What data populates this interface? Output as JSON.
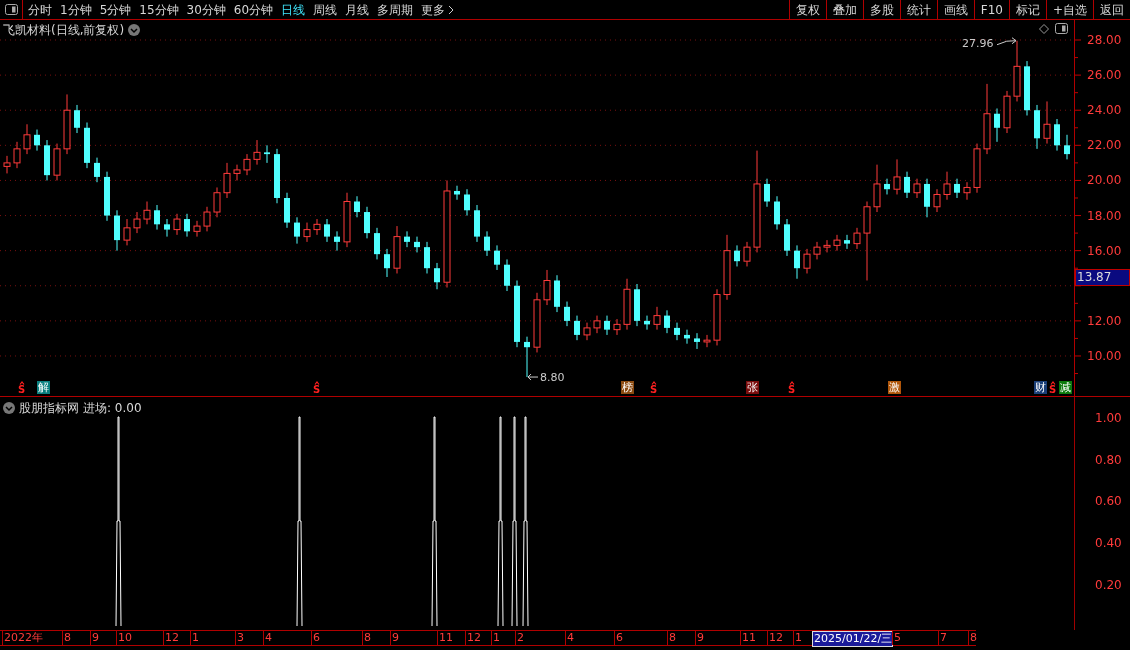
{
  "toolbar": {
    "periods": [
      {
        "label": "分时",
        "selected": false
      },
      {
        "label": "1分钟",
        "selected": false
      },
      {
        "label": "5分钟",
        "selected": false
      },
      {
        "label": "15分钟",
        "selected": false
      },
      {
        "label": "30分钟",
        "selected": false
      },
      {
        "label": "60分钟",
        "selected": false
      },
      {
        "label": "日线",
        "selected": true
      },
      {
        "label": "周线",
        "selected": false
      },
      {
        "label": "月线",
        "selected": false
      },
      {
        "label": "多周期",
        "selected": false
      },
      {
        "label": "更多",
        "selected": false
      }
    ],
    "actions": [
      "复权",
      "叠加",
      "多股",
      "统计",
      "画线",
      "F10",
      "标记",
      "+自选",
      "返回"
    ]
  },
  "chart": {
    "title": "飞凯材料(日线,前复权)",
    "current_price": "13.87",
    "high_label": "27.96",
    "low_label": "8.80",
    "chart_data": {
      "type": "candlestick",
      "ylim": [
        7.72,
        29.14
      ],
      "grid": true,
      "yticks": [
        {
          "value": 28,
          "label": "28.00"
        },
        {
          "value": 26,
          "label": "26.00"
        },
        {
          "value": 24,
          "label": "24.00"
        },
        {
          "value": 22,
          "label": "22.00"
        },
        {
          "value": 20,
          "label": "20.00"
        },
        {
          "value": 18,
          "label": "18.00"
        },
        {
          "value": 16,
          "label": "16.00"
        },
        {
          "value": 12,
          "label": "12.00"
        },
        {
          "value": 10,
          "label": "10.00"
        }
      ],
      "ohlc": [
        [
          20.8,
          21.4,
          20.4,
          21.0
        ],
        [
          21.0,
          22.2,
          20.7,
          21.8
        ],
        [
          21.8,
          23.2,
          21.5,
          22.6
        ],
        [
          22.6,
          22.9,
          21.7,
          22.0
        ],
        [
          22.0,
          22.3,
          20.0,
          20.3
        ],
        [
          20.3,
          22.1,
          20.0,
          21.8
        ],
        [
          21.8,
          24.9,
          21.5,
          24.0
        ],
        [
          24.0,
          24.3,
          22.7,
          23.0
        ],
        [
          23.0,
          23.3,
          20.7,
          21.0
        ],
        [
          21.0,
          21.3,
          19.9,
          20.2
        ],
        [
          20.2,
          20.5,
          17.7,
          18.0
        ],
        [
          18.0,
          18.3,
          16.0,
          16.6
        ],
        [
          16.6,
          17.8,
          16.3,
          17.3
        ],
        [
          17.3,
          18.2,
          17.0,
          17.8
        ],
        [
          17.8,
          18.8,
          17.5,
          18.3
        ],
        [
          18.3,
          18.6,
          17.2,
          17.5
        ],
        [
          17.5,
          17.8,
          16.8,
          17.2
        ],
        [
          17.2,
          18.1,
          16.9,
          17.8
        ],
        [
          17.8,
          18.1,
          16.8,
          17.1
        ],
        [
          17.1,
          17.7,
          16.8,
          17.4
        ],
        [
          17.4,
          18.5,
          17.1,
          18.2
        ],
        [
          18.2,
          19.6,
          17.9,
          19.3
        ],
        [
          19.3,
          21.0,
          19.0,
          20.4
        ],
        [
          20.4,
          20.9,
          20.0,
          20.6
        ],
        [
          20.6,
          21.5,
          20.3,
          21.2
        ],
        [
          21.2,
          22.3,
          20.9,
          21.6
        ],
        [
          21.6,
          22.0,
          21.0,
          21.5
        ],
        [
          21.5,
          21.8,
          18.7,
          19.0
        ],
        [
          19.0,
          19.3,
          17.3,
          17.6
        ],
        [
          17.6,
          17.9,
          16.4,
          16.8
        ],
        [
          16.8,
          17.6,
          16.5,
          17.2
        ],
        [
          17.2,
          17.8,
          16.9,
          17.5
        ],
        [
          17.5,
          17.8,
          16.5,
          16.8
        ],
        [
          16.8,
          17.1,
          16.0,
          16.5
        ],
        [
          16.5,
          19.3,
          16.2,
          18.8
        ],
        [
          18.8,
          19.1,
          17.9,
          18.2
        ],
        [
          18.2,
          18.5,
          16.7,
          17.0
        ],
        [
          17.0,
          17.3,
          15.5,
          15.8
        ],
        [
          15.8,
          16.1,
          14.5,
          15.0
        ],
        [
          15.0,
          17.4,
          14.7,
          16.8
        ],
        [
          16.8,
          17.1,
          16.2,
          16.5
        ],
        [
          16.5,
          16.8,
          15.9,
          16.2
        ],
        [
          16.2,
          16.5,
          14.7,
          15.0
        ],
        [
          15.0,
          15.3,
          13.8,
          14.2
        ],
        [
          14.2,
          20.0,
          13.9,
          19.4
        ],
        [
          19.4,
          19.7,
          18.9,
          19.2
        ],
        [
          19.2,
          19.5,
          18.0,
          18.3
        ],
        [
          18.3,
          18.6,
          16.5,
          16.8
        ],
        [
          16.8,
          17.1,
          15.7,
          16.0
        ],
        [
          16.0,
          16.3,
          14.9,
          15.2
        ],
        [
          15.2,
          15.5,
          13.7,
          14.0
        ],
        [
          14.0,
          14.3,
          10.5,
          10.8
        ],
        [
          10.8,
          11.1,
          8.8,
          10.5
        ],
        [
          10.5,
          13.6,
          10.2,
          13.2
        ],
        [
          13.2,
          14.9,
          12.9,
          14.3
        ],
        [
          14.3,
          14.6,
          12.5,
          12.8
        ],
        [
          12.8,
          13.1,
          11.7,
          12.0
        ],
        [
          12.0,
          12.3,
          10.9,
          11.2
        ],
        [
          11.2,
          11.9,
          10.9,
          11.6
        ],
        [
          11.6,
          12.3,
          11.3,
          12.0
        ],
        [
          12.0,
          12.3,
          11.2,
          11.5
        ],
        [
          11.5,
          12.1,
          11.2,
          11.8
        ],
        [
          11.8,
          14.4,
          11.5,
          13.8
        ],
        [
          13.8,
          14.1,
          11.7,
          12.0
        ],
        [
          12.0,
          12.3,
          11.5,
          11.8
        ],
        [
          11.8,
          12.8,
          11.5,
          12.3
        ],
        [
          12.3,
          12.6,
          11.3,
          11.6
        ],
        [
          11.6,
          11.9,
          10.9,
          11.2
        ],
        [
          11.2,
          11.5,
          10.7,
          11.0
        ],
        [
          11.0,
          11.3,
          10.4,
          10.8
        ],
        [
          10.8,
          11.2,
          10.5,
          10.9
        ],
        [
          10.9,
          13.8,
          10.6,
          13.5
        ],
        [
          13.5,
          16.9,
          13.2,
          16.0
        ],
        [
          16.0,
          16.3,
          15.1,
          15.4
        ],
        [
          15.4,
          16.5,
          15.1,
          16.2
        ],
        [
          16.2,
          21.7,
          15.9,
          19.8
        ],
        [
          19.8,
          20.1,
          18.5,
          18.8
        ],
        [
          18.8,
          19.1,
          17.2,
          17.5
        ],
        [
          17.5,
          17.8,
          15.7,
          16.0
        ],
        [
          16.0,
          16.3,
          14.4,
          15.0
        ],
        [
          15.0,
          16.1,
          14.7,
          15.8
        ],
        [
          15.8,
          16.5,
          15.5,
          16.2
        ],
        [
          16.2,
          16.6,
          15.9,
          16.3
        ],
        [
          16.3,
          16.9,
          16.0,
          16.6
        ],
        [
          16.6,
          16.9,
          16.1,
          16.4
        ],
        [
          16.4,
          17.3,
          16.1,
          17.0
        ],
        [
          17.0,
          18.8,
          14.3,
          18.5
        ],
        [
          18.5,
          20.9,
          18.2,
          19.8
        ],
        [
          19.8,
          20.1,
          19.2,
          19.5
        ],
        [
          19.5,
          21.2,
          19.2,
          20.2
        ],
        [
          20.2,
          20.5,
          19.0,
          19.3
        ],
        [
          19.3,
          20.1,
          19.0,
          19.8
        ],
        [
          19.8,
          20.1,
          17.9,
          18.5
        ],
        [
          18.5,
          19.5,
          18.2,
          19.2
        ],
        [
          19.2,
          20.5,
          18.9,
          19.8
        ],
        [
          19.8,
          20.1,
          19.0,
          19.3
        ],
        [
          19.3,
          19.9,
          18.9,
          19.6
        ],
        [
          19.6,
          22.1,
          19.3,
          21.8
        ],
        [
          21.8,
          25.5,
          21.5,
          23.8
        ],
        [
          23.8,
          24.1,
          22.2,
          23.0
        ],
        [
          23.0,
          25.1,
          22.7,
          24.8
        ],
        [
          24.8,
          27.96,
          24.5,
          26.5
        ],
        [
          26.5,
          26.8,
          23.7,
          24.0
        ],
        [
          24.0,
          24.3,
          21.8,
          22.4
        ],
        [
          22.4,
          24.5,
          22.1,
          23.2
        ],
        [
          23.2,
          23.5,
          21.7,
          22.0
        ],
        [
          22.0,
          22.6,
          21.2,
          21.5
        ]
      ]
    },
    "markers": [
      {
        "kind": "dividend",
        "text": "S"
      },
      {
        "kind": "tag",
        "text": "解",
        "color": "#0a7f7f"
      },
      {
        "kind": "dividend",
        "text": "S"
      },
      {
        "kind": "tag",
        "text": "榜",
        "color": "#8b4a10"
      },
      {
        "kind": "dividend",
        "text": "S"
      },
      {
        "kind": "tag",
        "text": "张",
        "color": "#7a0c0c"
      },
      {
        "kind": "dividend",
        "text": "S"
      },
      {
        "kind": "tag",
        "text": "激",
        "color": "#b0560a"
      },
      {
        "kind": "tag",
        "text": "财",
        "color": "#1b3f78"
      },
      {
        "kind": "dividend",
        "text": "S"
      },
      {
        "kind": "tag",
        "text": "减",
        "color": "#0c7a0c"
      }
    ]
  },
  "indicator": {
    "name": "股朋指标网",
    "reading": "进场: 0.00",
    "axis": [
      "1.00",
      "0.80",
      "0.60",
      "0.40",
      "0.20"
    ]
  },
  "date_axis": [
    {
      "label": "2022年",
      "selected": false
    },
    {
      "label": "8",
      "selected": false
    },
    {
      "label": "9",
      "selected": false
    },
    {
      "label": "10",
      "selected": false
    },
    {
      "label": "12",
      "selected": false
    },
    {
      "label": "1",
      "selected": false
    },
    {
      "label": "3",
      "selected": false
    },
    {
      "label": "4",
      "selected": false
    },
    {
      "label": "6",
      "selected": false
    },
    {
      "label": "8",
      "selected": false
    },
    {
      "label": "9",
      "selected": false
    },
    {
      "label": "11",
      "selected": false
    },
    {
      "label": "12",
      "selected": false
    },
    {
      "label": "1",
      "selected": false
    },
    {
      "label": "2",
      "selected": false
    },
    {
      "label": "4",
      "selected": false
    },
    {
      "label": "6",
      "selected": false
    },
    {
      "label": "8",
      "selected": false
    },
    {
      "label": "9",
      "selected": false
    },
    {
      "label": "11",
      "selected": false
    },
    {
      "label": "12",
      "selected": false
    },
    {
      "label": "1",
      "selected": false
    },
    {
      "label": "2025/01/22/三",
      "selected": true
    },
    {
      "label": "5",
      "selected": false
    },
    {
      "label": "7",
      "selected": false
    },
    {
      "label": "8",
      "selected": false
    }
  ]
}
